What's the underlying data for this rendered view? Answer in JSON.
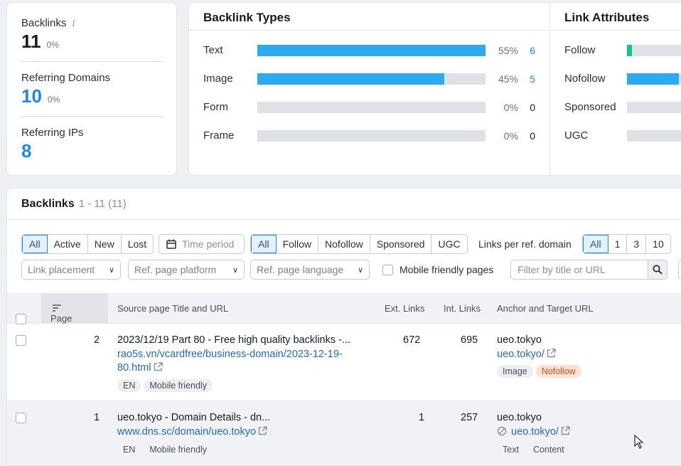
{
  "stats": {
    "backlinks_label": "Backlinks",
    "backlinks_value": "11",
    "backlinks_change": "0%",
    "refdomains_label": "Referring Domains",
    "refdomains_value": "10",
    "refdomains_change": "0%",
    "refips_label": "Referring IPs",
    "refips_value": "8"
  },
  "backlink_types": {
    "title": "Backlink Types",
    "rows": [
      {
        "label": "Text",
        "pct": "55%",
        "count": "6",
        "share": 1.0
      },
      {
        "label": "Image",
        "pct": "45%",
        "count": "5",
        "share": 0.82
      },
      {
        "label": "Form",
        "pct": "0%",
        "count": "0",
        "share": 0
      },
      {
        "label": "Frame",
        "pct": "0%",
        "count": "0",
        "share": 0
      }
    ]
  },
  "link_attributes": {
    "title": "Link Attributes",
    "rows": [
      {
        "label": "Follow",
        "color": "#14c38e",
        "share": 0.09
      },
      {
        "label": "Nofollow",
        "color": "#2bacf2",
        "share": 0.91
      },
      {
        "label": "Sponsored",
        "color": "#dfe1e7",
        "share": 0
      },
      {
        "label": "UGC",
        "color": "#dfe1e7",
        "share": 0
      }
    ]
  },
  "table": {
    "title": "Backlinks",
    "range": "1 - 11 (11)",
    "status_filters": [
      "All",
      "Active",
      "New",
      "Lost"
    ],
    "time_period": "Time period",
    "type_filters": [
      "All",
      "Follow",
      "Nofollow",
      "Sponsored",
      "UGC"
    ],
    "links_per_label": "Links per ref. domain",
    "links_per": [
      "All",
      "1",
      "3",
      "10"
    ],
    "link_placement": "Link placement",
    "ref_platform": "Ref. page platform",
    "ref_language": "Ref. page language",
    "mobile_friendly": "Mobile friendly pages",
    "search_placeholder": "Filter by title or URL",
    "columns": {
      "page_as": "Page AS",
      "source": "Source page Title and URL",
      "ext": "Ext. Links",
      "int": "Int. Links",
      "anchor": "Anchor and Target URL"
    },
    "rows": [
      {
        "page_as": "2",
        "title": "2023/12/19 Part 80 - Free high quality backlinks -...",
        "url_line1": "rao5s.vn/vcardfree/business-domain/2023-12-19-",
        "url_line2": "80.html",
        "lang": "EN",
        "mobile": "Mobile friendly",
        "ext": "672",
        "int": "695",
        "anchor": "ueo.tokyo",
        "target": "ueo.tokyo/",
        "tag1": "Image",
        "tag2": "Nofollow"
      },
      {
        "page_as": "1",
        "title": "ueo.tokyo - Domain Details - dn...",
        "url_line1": "www.dns.sc/domain/ueo.tokyo",
        "lang": "EN",
        "mobile": "Mobile friendly",
        "ext": "1",
        "int": "257",
        "anchor": "ueo.tokyo",
        "target": "ueo.tokyo/",
        "tag1": "Text",
        "tag2": "Content"
      }
    ]
  }
}
